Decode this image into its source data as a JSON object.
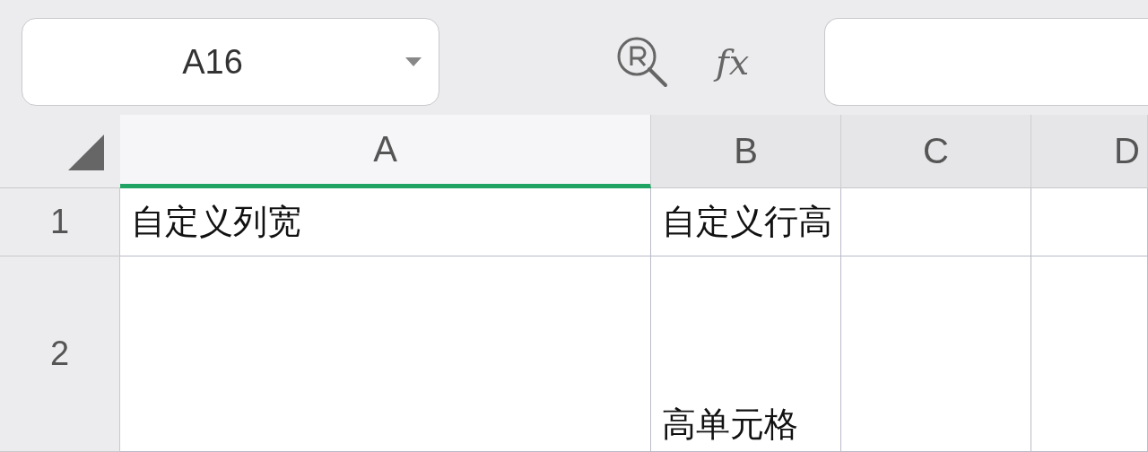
{
  "name_box": {
    "value": "A16"
  },
  "formula_bar": {
    "function_label": "fx"
  },
  "columns": [
    {
      "label": "A",
      "selected": true
    },
    {
      "label": "B",
      "selected": false
    },
    {
      "label": "C",
      "selected": false
    },
    {
      "label": "D",
      "selected": false
    }
  ],
  "rows": [
    {
      "label": "1",
      "cells": [
        "自定义列宽",
        "自定义行高",
        null,
        null
      ]
    },
    {
      "label": "2",
      "cells": [
        null,
        "高单元格",
        null,
        null
      ]
    }
  ]
}
